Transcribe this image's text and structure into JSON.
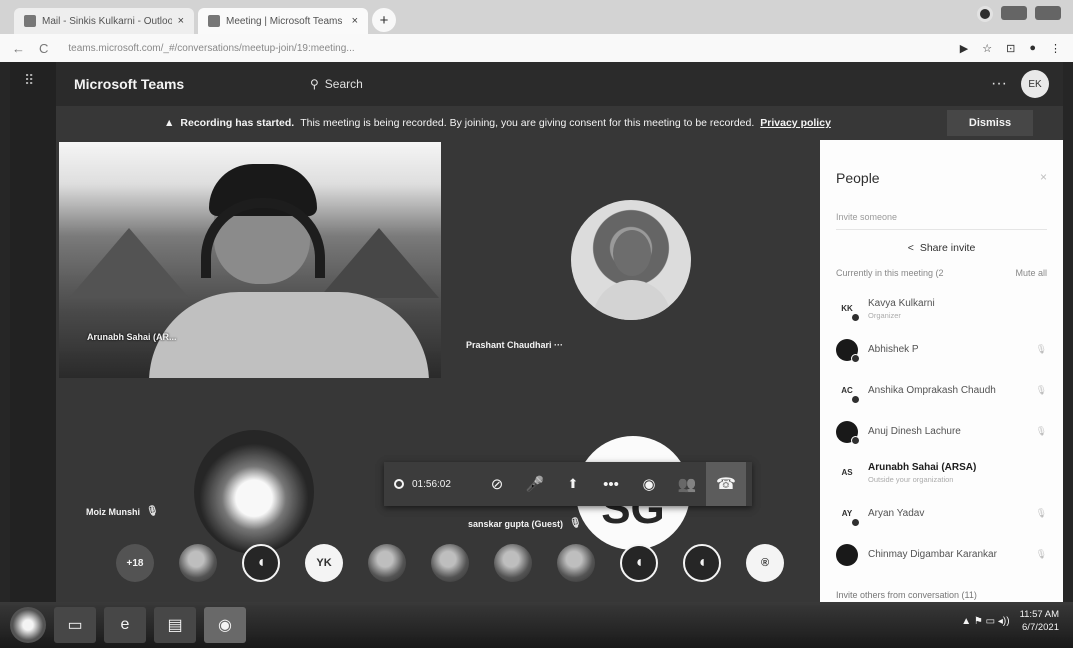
{
  "browser": {
    "tab1_title": "Mail - Sinkis Kulkarni - Outlook",
    "tab2_title": "Meeting | Microsoft Teams",
    "tab_close": "×",
    "new_tab": "+",
    "back": "←",
    "reload": "C",
    "url": "teams.microsoft.com/_#/conversations/meetup-join/19:meeting..."
  },
  "app": {
    "brand": "Microsoft Teams",
    "search_label": "Search",
    "more": "···",
    "me_initials": "EK"
  },
  "banner": {
    "bold": "Recording has started.",
    "text": "This meeting is being recorded. By joining, you are giving consent for this meeting to be recorded.",
    "privacy_link": "Privacy policy",
    "dismiss": "Dismiss"
  },
  "stage": {
    "main_name": "Arunabh Sahai (AR...",
    "prashant_name": "Prashant Chaudhari",
    "prashant_more": "···",
    "moiz_name": "Moiz Munshi",
    "sg_initials": "SG",
    "sg_name": "sanskar gupta (Guest)"
  },
  "callbar": {
    "timer": "01:56:02"
  },
  "avatars": {
    "more_count": "+18",
    "yk": "YK"
  },
  "people": {
    "title": "People",
    "invite_placeholder": "Invite someone",
    "share_invite": "Share invite",
    "in_meeting": "Currently in this meeting (2",
    "mute_all": "Mute all",
    "invite_others": "Invite others from conversation (11)",
    "list": [
      {
        "initials": "KK",
        "name": "Kavya Kulkarni",
        "sub": "Organizer",
        "bold": false
      },
      {
        "initials": "",
        "name": "Abhishek P",
        "sub": "",
        "bold": false
      },
      {
        "initials": "AC",
        "name": "Anshika Omprakash Chaudh",
        "sub": "",
        "bold": false
      },
      {
        "initials": "",
        "name": "Anuj Dinesh Lachure",
        "sub": "",
        "bold": false
      },
      {
        "initials": "AS",
        "name": "Arunabh Sahai (ARSA)",
        "sub": "Outside your organization",
        "bold": true
      },
      {
        "initials": "AY",
        "name": "Aryan Yadav",
        "sub": "",
        "bold": false
      },
      {
        "initials": "",
        "name": "Chinmay Digambar Karankar",
        "sub": "",
        "bold": false
      }
    ]
  },
  "taskbar": {
    "time": "11:57 AM",
    "date": "6/7/2021"
  }
}
